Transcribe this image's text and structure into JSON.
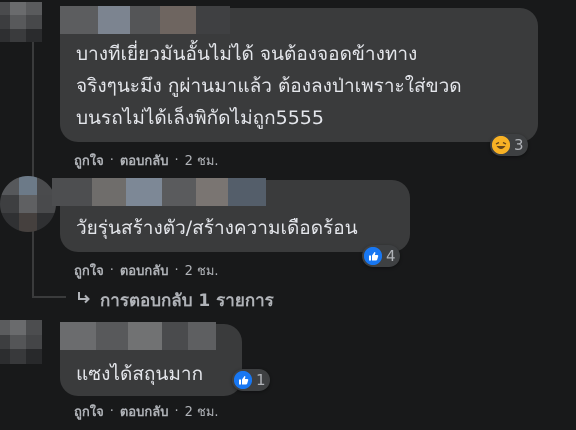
{
  "comments": [
    {
      "lines": [
        "บางทีเยี่ยวมันอั้นไม่ได้ จนต้องจอดข้างทาง",
        "จริงๆนะมึง กูผ่านมาแล้ว ต้องลงป่าเพราะใส่ขวด",
        "บนรถไม่ได้เล็งพิกัดไม่ถูก5555"
      ],
      "reaction_icon": "haha-icon",
      "reaction_count": "3"
    },
    {
      "lines": [
        "วัยรุ่นสร้างตัว/สร้างความเดือดร้อน"
      ],
      "reaction_icon": "like-icon",
      "reaction_count": "4"
    },
    {
      "lines": [
        "แซงได้สถุนมาก"
      ],
      "reaction_icon": "like-icon",
      "reaction_count": "1"
    }
  ],
  "actions": {
    "like": "ถูกใจ",
    "reply": "ตอบกลับ",
    "time": "2 ชม.",
    "separator": "·"
  },
  "replies": {
    "arrow_icon": "reply-arrow-icon",
    "label": "การตอบกลับ 1 รายการ"
  },
  "colors": {
    "background": "#18191a",
    "bubble": "#3a3b3c",
    "text": "#e4e6eb",
    "secondary": "#b0b3b8",
    "like_blue": "#1877f2",
    "haha_yellow": "#f7b125"
  }
}
